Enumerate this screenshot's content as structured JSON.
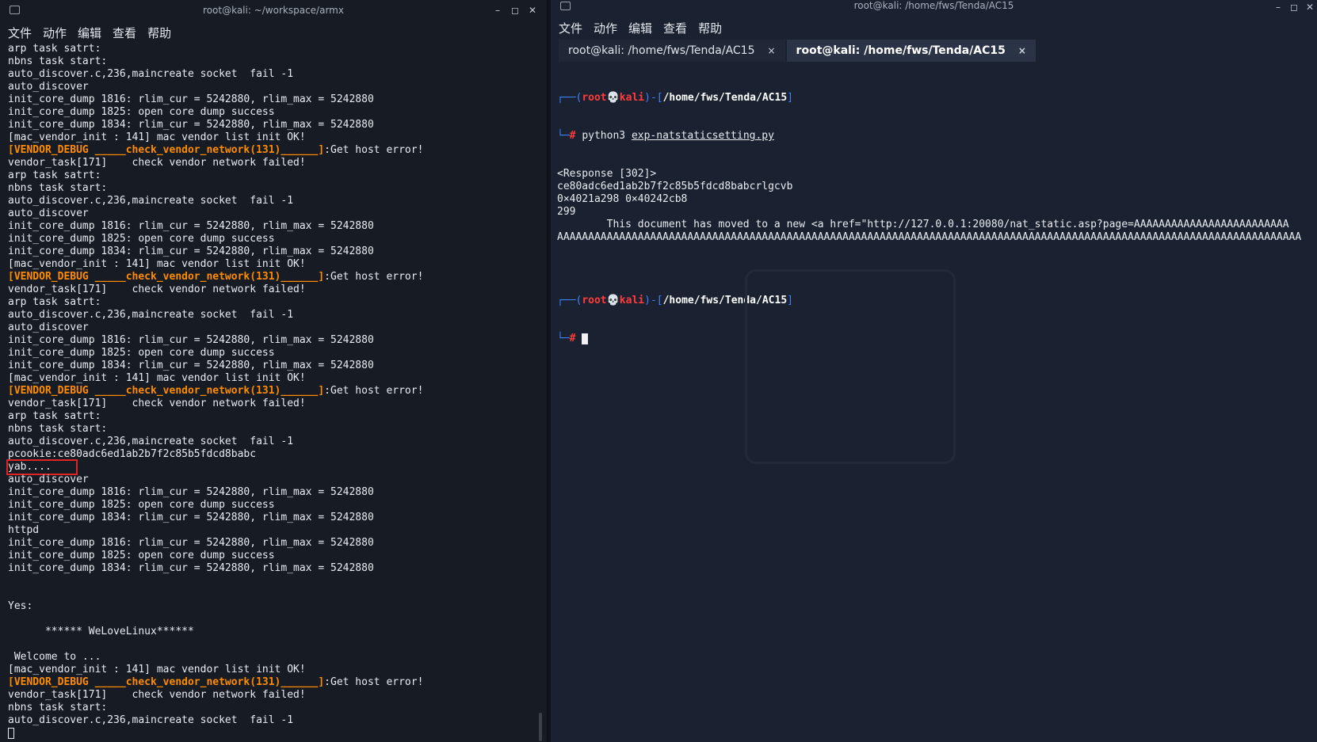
{
  "left_window": {
    "title": "root@kali: ~/workspace/armx",
    "controls": {
      "minimize": "–",
      "maximize": "◻",
      "close": "✕"
    },
    "menu": [
      "文件",
      "动作",
      "编辑",
      "查看",
      "帮助"
    ],
    "lines": [
      "arp task satrt:",
      "nbns task start:",
      "auto_discover.c,236,maincreate socket  fail -1",
      "auto_discover",
      "init_core_dump 1816: rlim_cur = 5242880, rlim_max = 5242880",
      "init_core_dump 1825: open core dump success",
      "init_core_dump 1834: rlim_cur = 5242880, rlim_max = 5242880",
      "[mac_vendor_init : 141] mac vendor list init OK!",
      "",
      "vendor_task[171]    check vendor network failed!",
      "arp task satrt:",
      "nbns task start:",
      "auto_discover.c,236,maincreate socket  fail -1",
      "auto_discover",
      "init_core_dump 1816: rlim_cur = 5242880, rlim_max = 5242880",
      "init_core_dump 1825: open core dump success",
      "init_core_dump 1834: rlim_cur = 5242880, rlim_max = 5242880",
      "[mac_vendor_init : 141] mac vendor list init OK!",
      "",
      "vendor_task[171]    check vendor network failed!",
      "arp task satrt:",
      "auto_discover.c,236,maincreate socket  fail -1",
      "auto_discover",
      "init_core_dump 1816: rlim_cur = 5242880, rlim_max = 5242880",
      "init_core_dump 1825: open core dump success",
      "init_core_dump 1834: rlim_cur = 5242880, rlim_max = 5242880",
      "[mac_vendor_init : 141] mac vendor list init OK!",
      "",
      "vendor_task[171]    check vendor network failed!",
      "arp task satrt:",
      "nbns task start:",
      "auto_discover.c,236,maincreate socket  fail -1",
      "pcookie:ce80adc6ed1ab2b7f2c85b5fdcd8babc",
      "",
      "auto_discover",
      "init_core_dump 1816: rlim_cur = 5242880, rlim_max = 5242880",
      "init_core_dump 1825: open core dump success",
      "init_core_dump 1834: rlim_cur = 5242880, rlim_max = 5242880",
      "httpd",
      "init_core_dump 1816: rlim_cur = 5242880, rlim_max = 5242880",
      "init_core_dump 1825: open core dump success",
      "init_core_dump 1834: rlim_cur = 5242880, rlim_max = 5242880",
      "",
      "",
      "Yes:",
      "",
      "      ****** WeLoveLinux******",
      "",
      " Welcome to ...",
      "[mac_vendor_init : 141] mac vendor list init OK!",
      "",
      "vendor_task[171]    check vendor network failed!",
      "nbns task start:",
      "auto_discover.c,236,maincreate socket  fail -1"
    ],
    "vendor_debug": "[VENDOR_DEBUG _____check_vendor_network(131)______]",
    "vendor_debug_tail": ":Get host error!",
    "highlighted": "yab...."
  },
  "right_window": {
    "title": "root@kali: /home/fws/Tenda/AC15",
    "controls": {
      "minimize": "–",
      "maximize": "◻",
      "close": "✕"
    },
    "menu": [
      "文件",
      "动作",
      "编辑",
      "查看",
      "帮助"
    ],
    "tabs": [
      {
        "label": "root@kali: /home/fws/Tenda/AC15",
        "close": "×"
      },
      {
        "label": "root@kali: /home/fws/Tenda/AC15",
        "close": "×"
      }
    ],
    "prompt": {
      "open": "┌──(",
      "user": "root💀kali",
      "mid": ")-[",
      "path": "/home/fws/Tenda/AC15",
      "close": "]",
      "hash_prefix": "└─",
      "hash": "#"
    },
    "command": {
      "program": "python3",
      "script": "exp-natstaticsetting.py"
    },
    "output": [
      "<Response [302]>",
      "ce80adc6ed1ab2b7f2c85b5fdcd8babcrlgcvb",
      "0×4021a298 0×40242cb8",
      "299",
      "",
      "        This document has moved to a new <a href=\"http://127.0.0.1:20080/nat_static.asp?page=AAAAAAAAAAAAAAAAAAAAAAAAA",
      "AAAAAAAAAAAAAAAAAAAAAAAAAAAAAAAAAAAAAAAAAAAAAAAAAAAAAAAAAAAAAAAAAAAAAAAAAAAAAAAAAAAAAAAAAAAAAAAAAAAAAAAAAAAAAAAAAAAAAAAA"
    ]
  },
  "colors": {
    "accent_orange": "#ff8c00",
    "prompt_blue": "#3f82ff",
    "prompt_red": "#ff3b3b",
    "highlight_box": "#e02424"
  }
}
